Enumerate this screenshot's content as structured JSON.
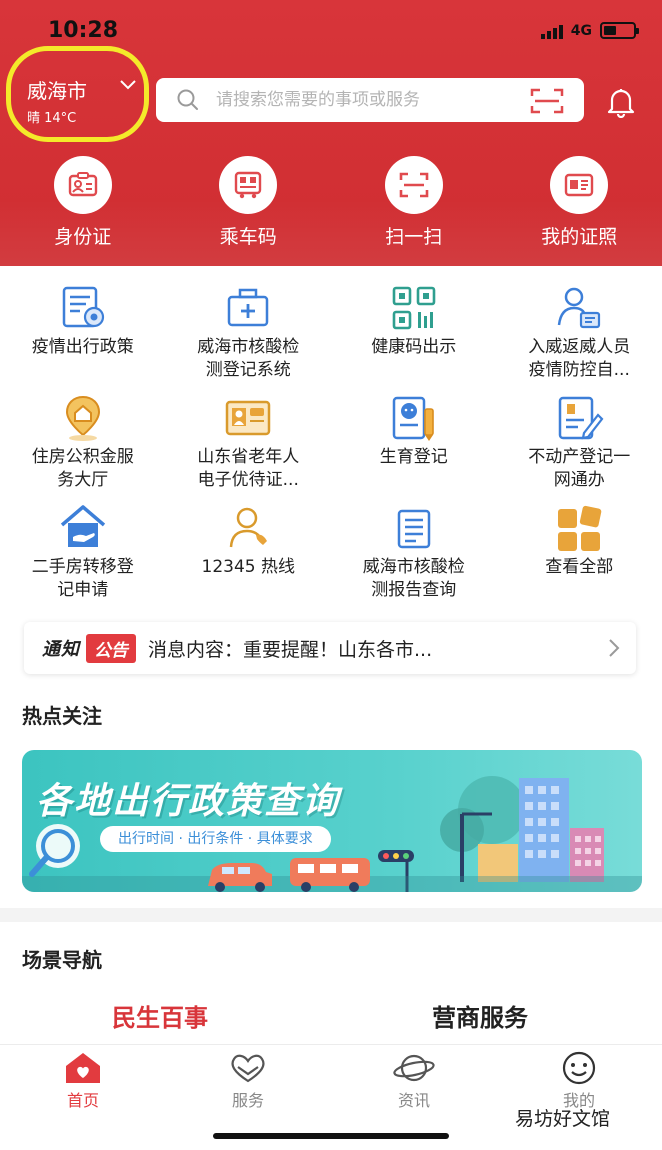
{
  "status_bar": {
    "time": "10:28",
    "network": "4G"
  },
  "header": {
    "city": "威海市",
    "weather": "晴 14°C",
    "search_placeholder": "请搜索您需要的事项或服务",
    "quick_actions": [
      {
        "label": "身份证",
        "icon": "id-card-icon"
      },
      {
        "label": "乘车码",
        "icon": "bus-code-icon"
      },
      {
        "label": "扫一扫",
        "icon": "scan-icon"
      },
      {
        "label": "我的证照",
        "icon": "certificate-icon"
      }
    ]
  },
  "services": [
    {
      "label": "疫情出行政策",
      "icon": "policy-doc-icon"
    },
    {
      "label": "威海市核酸检\n测登记系统",
      "icon": "medical-kit-icon"
    },
    {
      "label": "健康码出示",
      "icon": "qr-code-icon"
    },
    {
      "label": "入威返威人员\n疫情防控自...",
      "icon": "person-card-icon"
    },
    {
      "label": "住房公积金服\n务大厅",
      "icon": "house-pin-icon"
    },
    {
      "label": "山东省老年人\n电子优待证...",
      "icon": "elder-card-icon"
    },
    {
      "label": "生育登记",
      "icon": "baby-register-icon"
    },
    {
      "label": "不动产登记一\n网通办",
      "icon": "edit-doc-icon"
    },
    {
      "label": "二手房转移登\n记申请",
      "icon": "house-hand-icon"
    },
    {
      "label": "12345 热线",
      "icon": "hotline-icon"
    },
    {
      "label": "威海市核酸检\n测报告查询",
      "icon": "report-icon"
    },
    {
      "label": "查看全部",
      "icon": "all-apps-icon"
    }
  ],
  "notice": {
    "tag": "通知",
    "badge": "公告",
    "text": "消息内容：重要提醒！山东各市..."
  },
  "hot_topics": {
    "title": "热点关注",
    "banner_title": "各地出行政策查询",
    "banner_subtitle": "出行时间 · 出行条件 · 具体要求"
  },
  "scene_nav": {
    "title": "场景导航",
    "tabs": [
      {
        "label": "民生百事",
        "active": true
      },
      {
        "label": "营商服务",
        "active": false
      }
    ]
  },
  "tab_bar": {
    "items": [
      {
        "label": "首页",
        "icon": "home-icon",
        "active": true
      },
      {
        "label": "服务",
        "icon": "heart-hands-icon",
        "active": false
      },
      {
        "label": "资讯",
        "icon": "planet-icon",
        "active": false
      },
      {
        "label": "我的",
        "icon": "smiley-icon",
        "active": false
      }
    ]
  },
  "watermark": "易坊好文馆",
  "colors": {
    "brand_red": "#d8353a",
    "highlight_yellow": "#f4ea2a",
    "icon_blue": "#3d7fd8",
    "icon_orange": "#e8a43a",
    "banner_teal": "#3cc4c0",
    "inactive_gray": "#888888"
  }
}
